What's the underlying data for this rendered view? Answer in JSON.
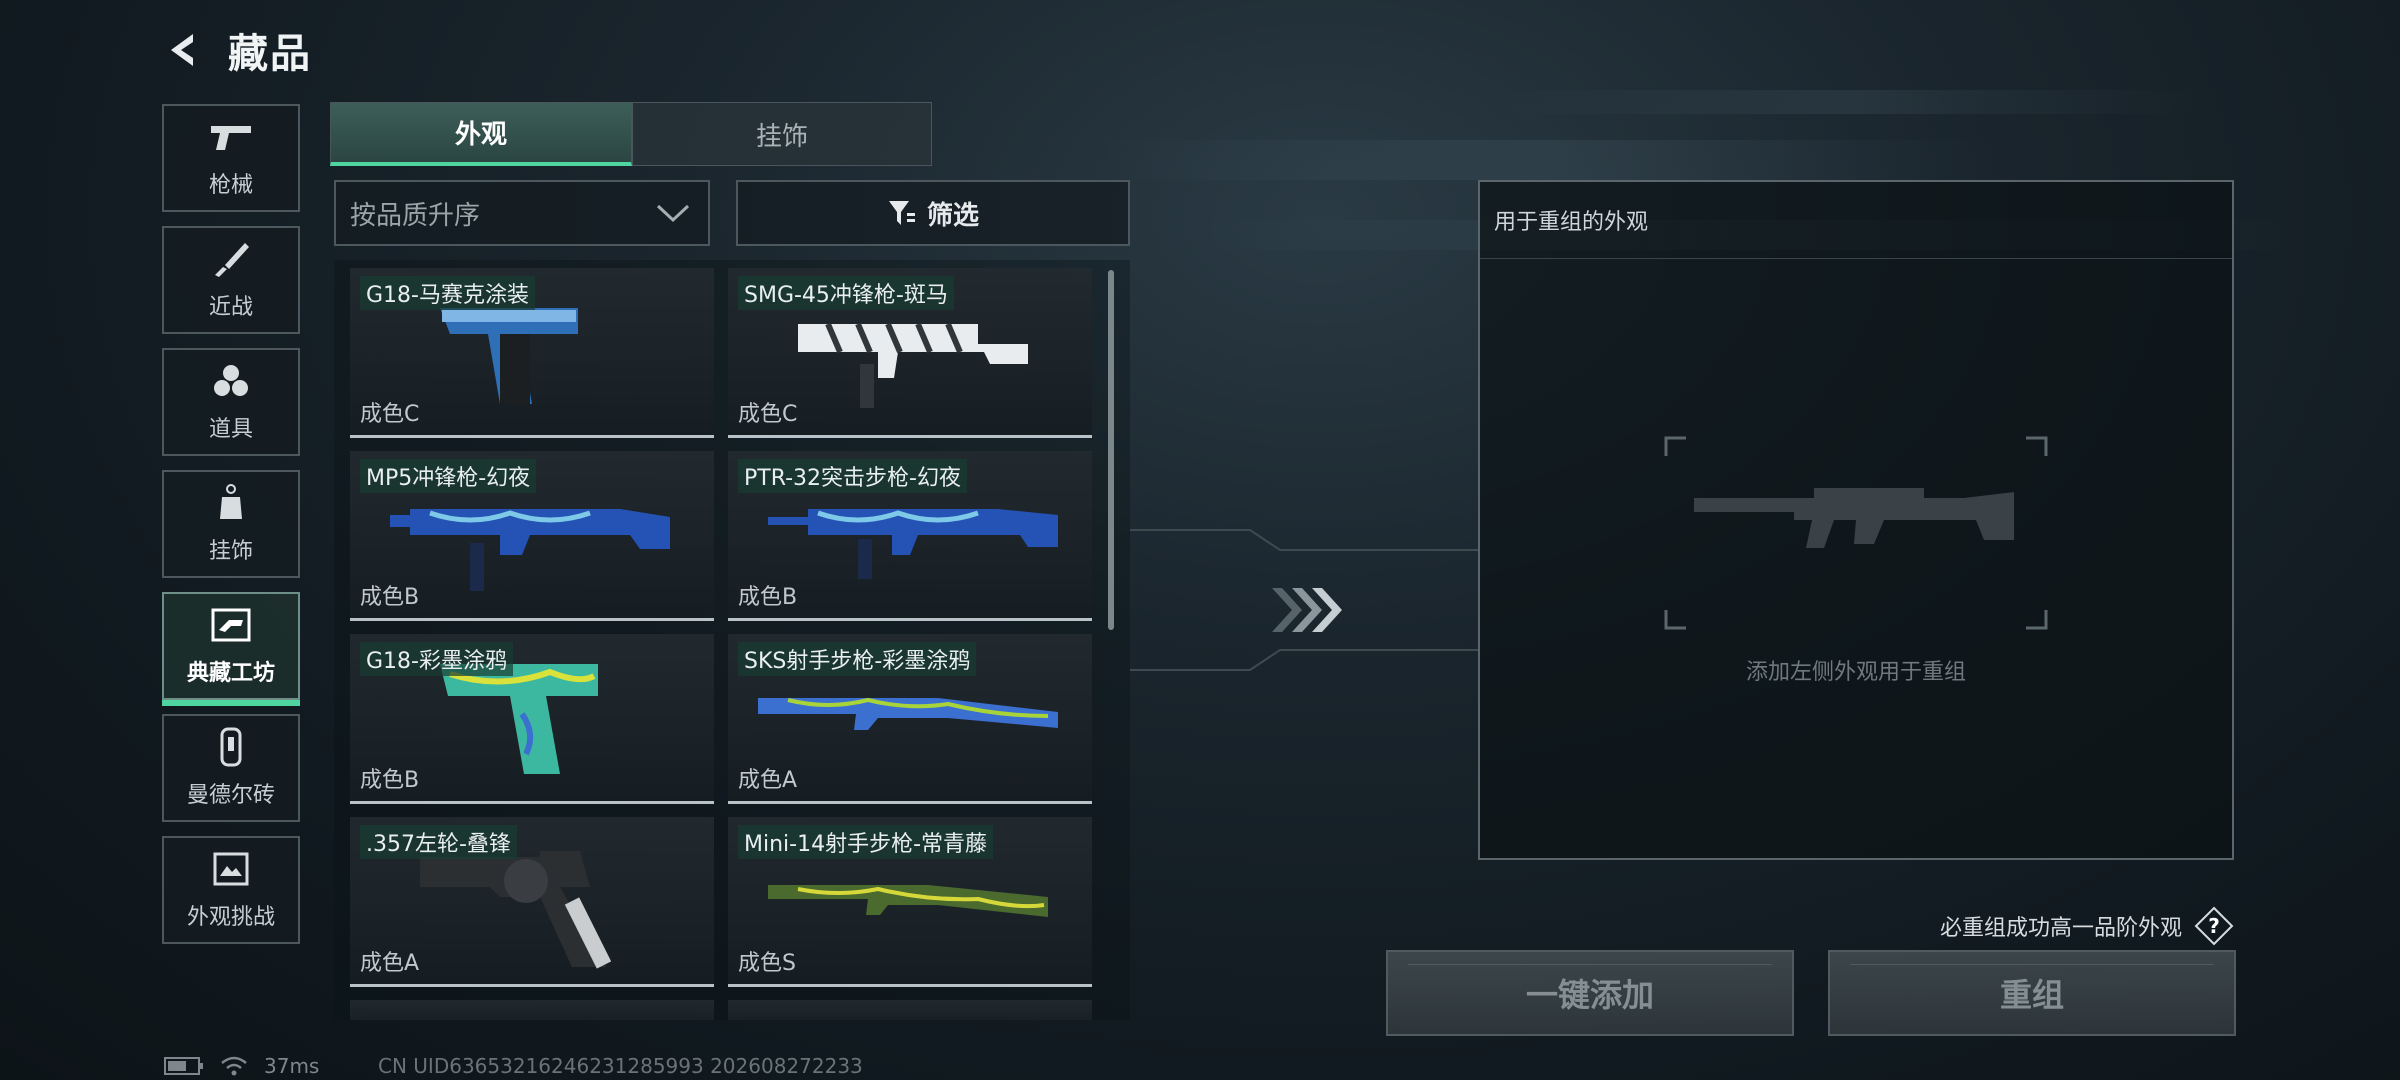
{
  "header": {
    "title": "藏品"
  },
  "sidebar": {
    "items": [
      {
        "label": "枪械",
        "icon": "pistol-icon"
      },
      {
        "label": "近战",
        "icon": "knife-icon"
      },
      {
        "label": "道具",
        "icon": "grenade-icon"
      },
      {
        "label": "挂饰",
        "icon": "charm-icon"
      },
      {
        "label": "典藏工坊",
        "icon": "workshop-icon",
        "active": true
      },
      {
        "label": "曼德尔砖",
        "icon": "brick-icon"
      },
      {
        "label": "外观挑战",
        "icon": "challenge-icon"
      }
    ]
  },
  "tabs": [
    {
      "label": "外观",
      "active": true
    },
    {
      "label": "挂饰",
      "active": false
    }
  ],
  "sort": {
    "label": "按品质升序"
  },
  "filter": {
    "label": "筛选"
  },
  "skins": [
    {
      "name": "G18-马赛克涂装",
      "grade": "成色C",
      "palette": [
        "#2f6fb8",
        "#7fb6e6"
      ],
      "kind": "pistol"
    },
    {
      "name": "SMG-45冲锋枪-斑马",
      "grade": "成色C",
      "palette": [
        "#e9ecee",
        "#30363a"
      ],
      "kind": "smg"
    },
    {
      "name": "MP5冲锋枪-幻夜",
      "grade": "成色B",
      "palette": [
        "#2452b5",
        "#7ec8e8"
      ],
      "kind": "smg"
    },
    {
      "name": "PTR-32突击步枪-幻夜",
      "grade": "成色B",
      "palette": [
        "#2452b5",
        "#7ec8e8"
      ],
      "kind": "rifle"
    },
    {
      "name": "G18-彩墨涂鸦",
      "grade": "成色B",
      "palette": [
        "#3db8a0",
        "#d8e23a"
      ],
      "kind": "pistol"
    },
    {
      "name": "SKS射手步枪-彩墨涂鸦",
      "grade": "成色A",
      "palette": [
        "#3b6fd0",
        "#a8d43a"
      ],
      "kind": "longrifle"
    },
    {
      "name": ".357左轮-叠锋",
      "grade": "成色A",
      "palette": [
        "#2c2f32",
        "#c9cdd0"
      ],
      "kind": "revolver"
    },
    {
      "name": "Mini-14射手步枪-常青藤",
      "grade": "成色S",
      "palette": [
        "#4a6a2e",
        "#d6d83a"
      ],
      "kind": "longrifle"
    }
  ],
  "panel": {
    "title": "用于重组的外观",
    "hint": "添加左侧外观用于重组"
  },
  "guarantee": {
    "text": "必重组成功高一品阶外观",
    "icon": "help-icon"
  },
  "buttons": {
    "add": "一键添加",
    "recombine": "重组"
  },
  "status": {
    "latency": "37ms",
    "uid": "CN UID636532162462312859​93 202608272233"
  },
  "colors": {
    "accent": "#4fd6a0",
    "panel_border": "#5a666c"
  }
}
